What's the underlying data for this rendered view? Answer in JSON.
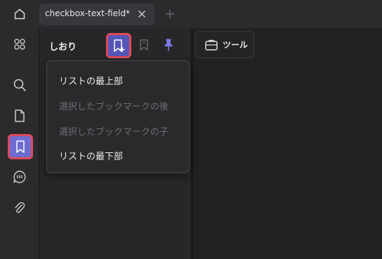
{
  "tab": {
    "title": "checkbox-text-field*"
  },
  "panel": {
    "title": "しおり"
  },
  "toolbar": {
    "tools_label": "ツール"
  },
  "menu": {
    "items": [
      {
        "label": "リストの最上部",
        "enabled": true
      },
      {
        "label": "選択したブックマークの後",
        "enabled": false
      },
      {
        "label": "選択したブックマークの子",
        "enabled": false
      },
      {
        "label": "リストの最下部",
        "enabled": true
      }
    ]
  },
  "colors": {
    "accent": "#6c6cd1",
    "highlight_border": "#e04a5a",
    "pin": "#7b7be8"
  }
}
